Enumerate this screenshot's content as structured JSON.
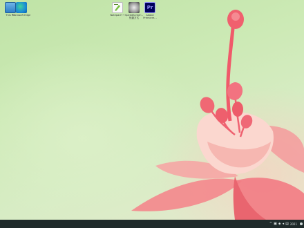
{
  "desktop": {
    "icons": [
      {
        "id": "this-pc",
        "label": "This PC",
        "icon": "computer-icon"
      },
      {
        "id": "edge",
        "label": "Microsoft Edge",
        "icon": "edge-icon"
      },
      {
        "id": "notepad",
        "label": "Notepad++",
        "icon": "notepad-icon"
      },
      {
        "id": "speedscreen",
        "label": "SpeedScreen - 快捷方式",
        "icon": "speedscreen-icon"
      },
      {
        "id": "premiere",
        "label": "Adobe Premiere...",
        "icon": "premiere-icon",
        "glyph": "Pr"
      }
    ]
  },
  "taskbar": {
    "tray": {
      "chevron": "^",
      "clock": "2021"
    }
  },
  "colors": {
    "taskbar": "#1f2a2a",
    "flower": "#f2737c"
  }
}
